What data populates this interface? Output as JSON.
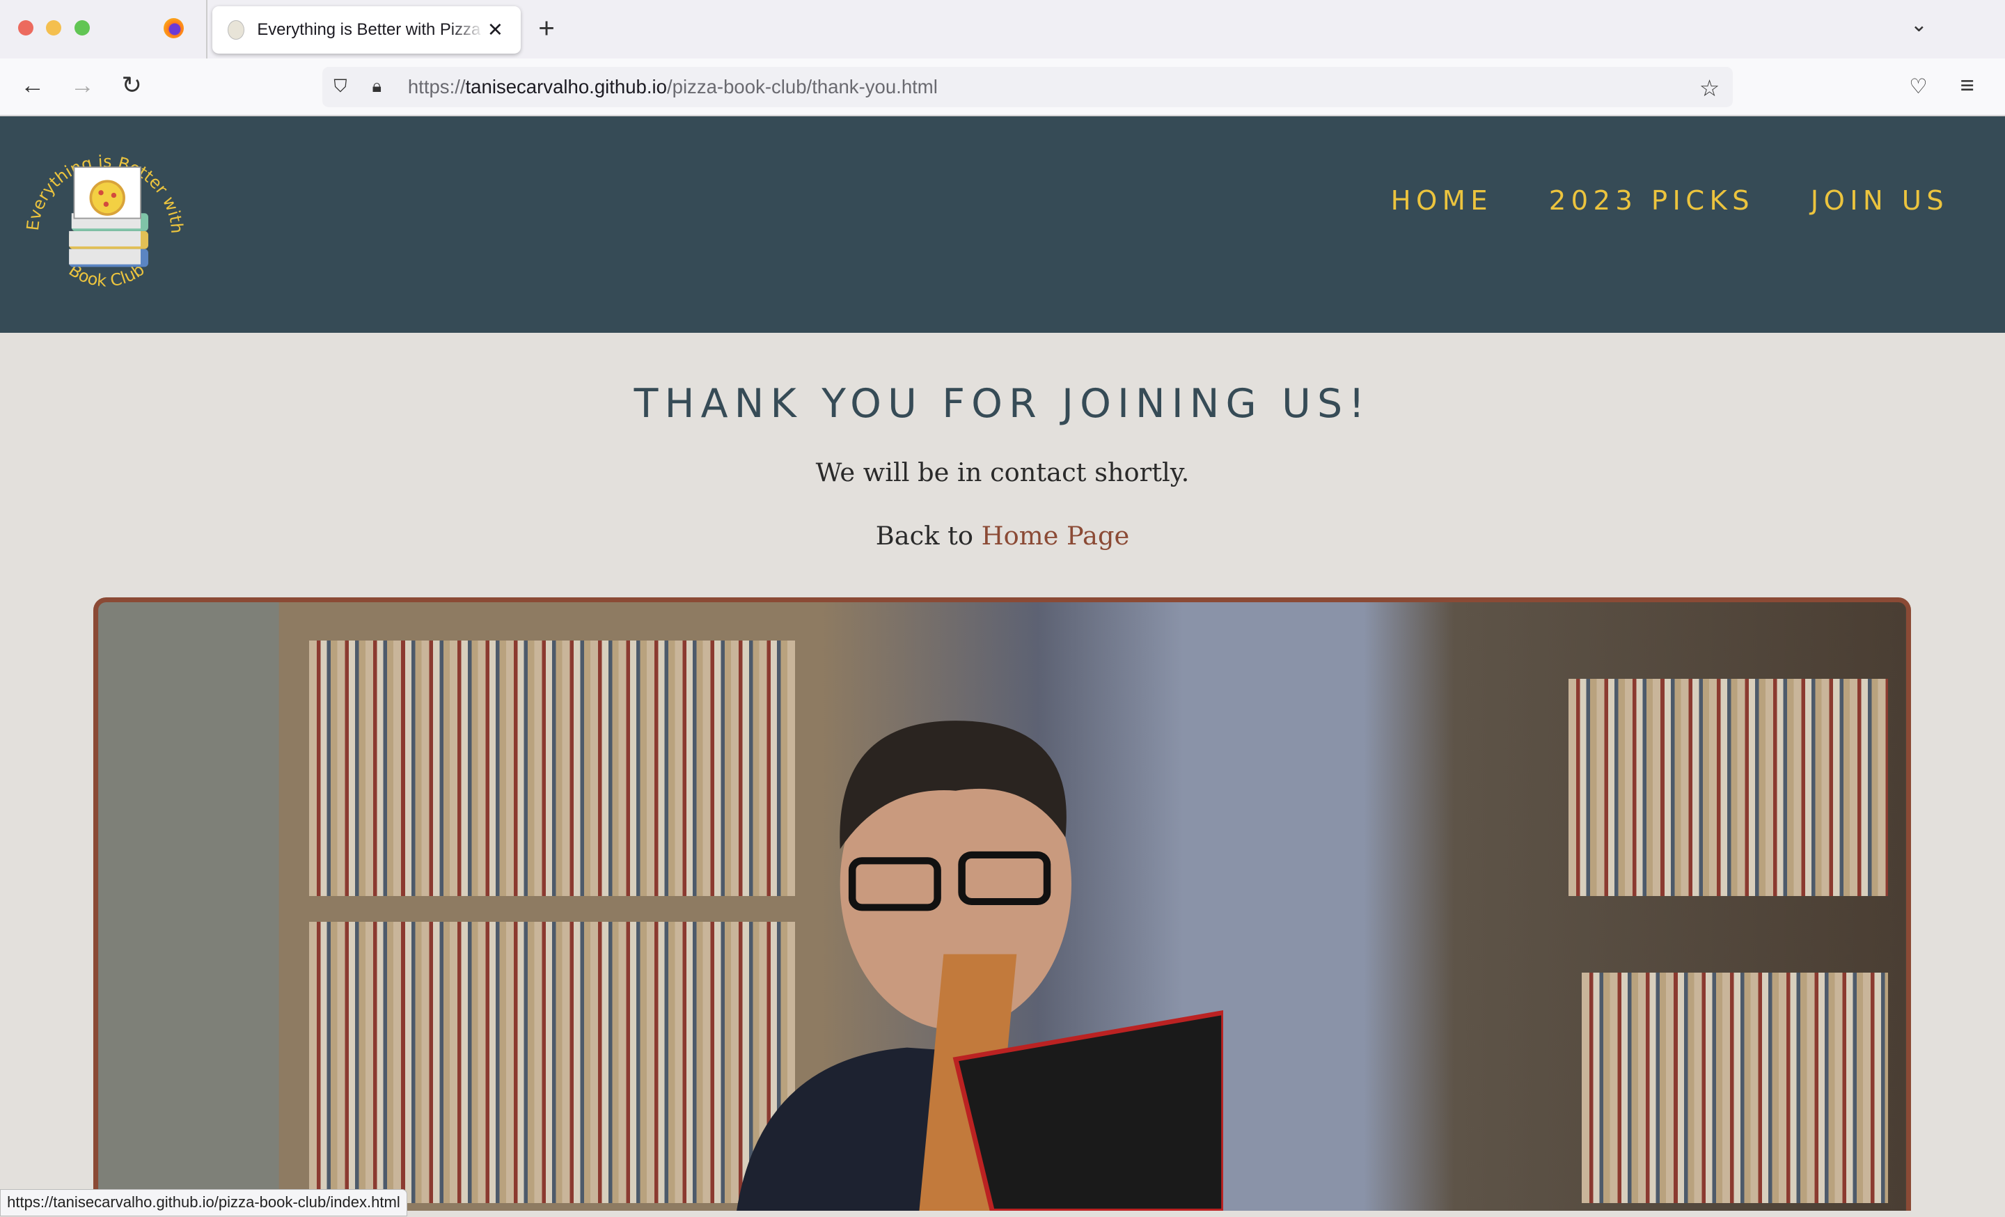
{
  "browser": {
    "tab_title": "Everything is Better with Pizza Book Club",
    "url_scheme": "https://",
    "url_host": "tanisecarvalho.github.io",
    "url_path": "/pizza-book-club/thank-you.html",
    "status_url": "https://tanisecarvalho.github.io/pizza-book-club/index.html"
  },
  "site": {
    "logo_text_top": "Everything is Better with Pizza",
    "logo_text_bottom": "Book Club",
    "nav": [
      "HOME",
      "2023 PICKS",
      "JOIN US"
    ],
    "accent": "#ecc43e",
    "header_bg": "#364b56"
  },
  "main": {
    "heading": "THANK YOU FOR JOINING US!",
    "message": "We will be in contact shortly.",
    "back_prefix": "Back to ",
    "back_link": "Home Page"
  }
}
